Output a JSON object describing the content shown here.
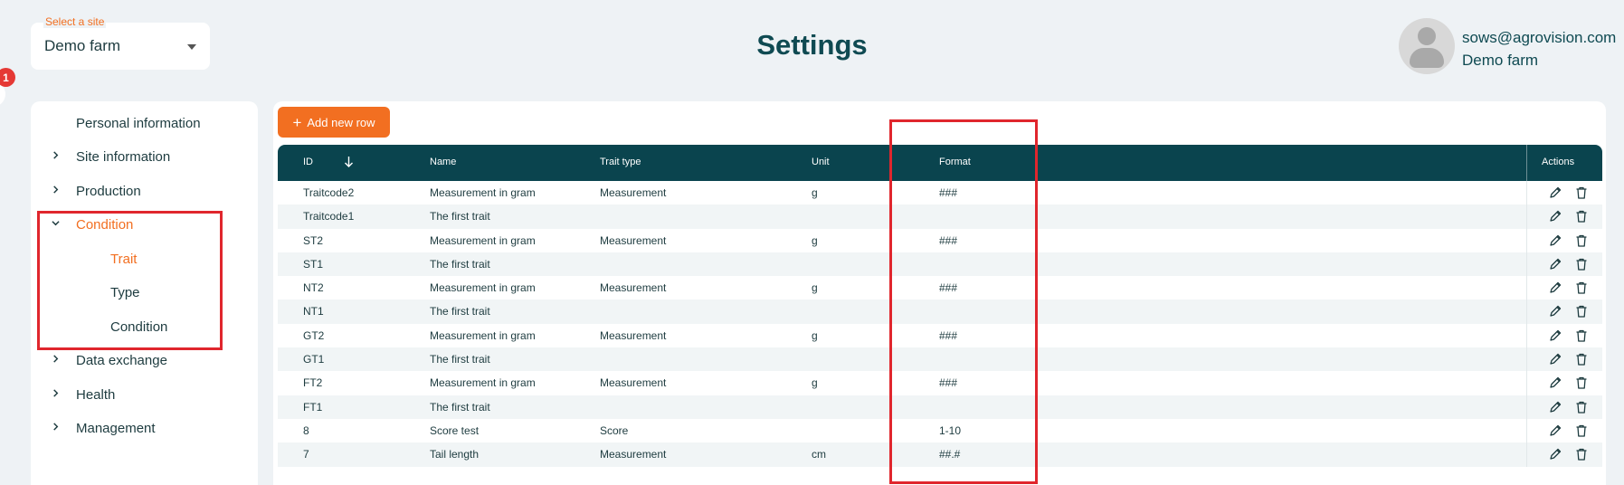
{
  "header": {
    "site_label": "Select a site",
    "site_value": "Demo farm",
    "title": "Settings",
    "notification_count": "1",
    "user_email": "sows@agrovision.com",
    "user_farm": "Demo farm"
  },
  "sidebar": {
    "items": [
      {
        "label": "Personal information"
      },
      {
        "label": "Site information"
      },
      {
        "label": "Production"
      },
      {
        "label": "Condition"
      },
      {
        "label": "Trait"
      },
      {
        "label": "Type"
      },
      {
        "label": "Condition"
      },
      {
        "label": "Data exchange"
      },
      {
        "label": "Health"
      },
      {
        "label": "Management"
      }
    ]
  },
  "toolbar": {
    "add_row_label": "Add new row"
  },
  "table": {
    "columns": {
      "id": "ID",
      "name": "Name",
      "trait_type": "Trait type",
      "unit": "Unit",
      "format": "Format",
      "actions": "Actions"
    },
    "rows": [
      {
        "id": "Traitcode2",
        "name": "Measurement in gram",
        "trait_type": "Measurement",
        "unit": "g",
        "format": "###"
      },
      {
        "id": "Traitcode1",
        "name": "The first trait",
        "trait_type": "",
        "unit": "",
        "format": ""
      },
      {
        "id": "ST2",
        "name": "Measurement in gram",
        "trait_type": "Measurement",
        "unit": "g",
        "format": "###"
      },
      {
        "id": "ST1",
        "name": "The first trait",
        "trait_type": "",
        "unit": "",
        "format": ""
      },
      {
        "id": "NT2",
        "name": "Measurement in gram",
        "trait_type": "Measurement",
        "unit": "g",
        "format": "###"
      },
      {
        "id": "NT1",
        "name": "The first trait",
        "trait_type": "",
        "unit": "",
        "format": ""
      },
      {
        "id": "GT2",
        "name": "Measurement in gram",
        "trait_type": "Measurement",
        "unit": "g",
        "format": "###"
      },
      {
        "id": "GT1",
        "name": "The first trait",
        "trait_type": "",
        "unit": "",
        "format": ""
      },
      {
        "id": "FT2",
        "name": "Measurement in gram",
        "trait_type": "Measurement",
        "unit": "g",
        "format": "###"
      },
      {
        "id": "FT1",
        "name": "The first trait",
        "trait_type": "",
        "unit": "",
        "format": ""
      },
      {
        "id": "8",
        "name": "Score test",
        "trait_type": "Score",
        "unit": "",
        "format": "1-10"
      },
      {
        "id": "7",
        "name": "Tail length",
        "trait_type": "Measurement",
        "unit": "cm",
        "format": "##.#"
      }
    ]
  },
  "colors": {
    "accent": "#f26f21",
    "header_bg": "#0a444e",
    "highlight": "#e0262d",
    "badge": "#e53935"
  }
}
